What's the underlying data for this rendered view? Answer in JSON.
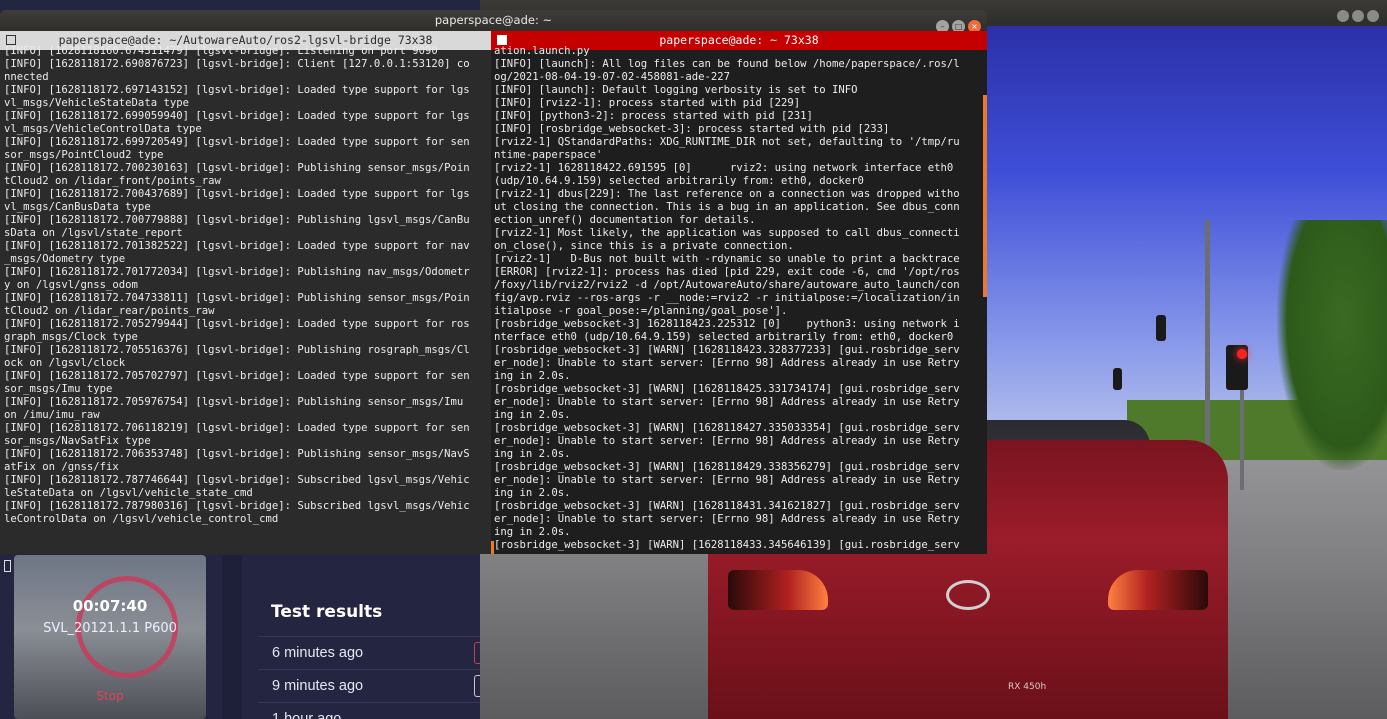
{
  "dashboard": {
    "simulation_card": {
      "timer": "00:07:40",
      "name": "SVL_20121.1.1 P600",
      "stop_label": "Stop"
    },
    "test_results": {
      "title": "Test results",
      "items": [
        {
          "label": "6 minutes ago"
        },
        {
          "label": "9 minutes ago"
        },
        {
          "label": "1 hour ago"
        }
      ]
    }
  },
  "simulator": {
    "car_model": "RX 450h"
  },
  "window_main": {
    "title": "paperspace@ade: ~"
  },
  "terminal_left": {
    "title": "paperspace@ade: ~/AutowareAuto/ros2-lgsvl-bridge 73x38",
    "lines": [
      "[INFO] [1628118160.674311479] [lgsvl-bridge]: Listening on port 9090",
      "[INFO] [1628118172.690876723] [lgsvl-bridge]: Client [127.0.0.1:53120] co",
      "nnected",
      "[INFO] [1628118172.697143152] [lgsvl-bridge]: Loaded type support for lgs",
      "vl_msgs/VehicleStateData type",
      "[INFO] [1628118172.699059940] [lgsvl-bridge]: Loaded type support for lgs",
      "vl_msgs/VehicleControlData type",
      "[INFO] [1628118172.699720549] [lgsvl-bridge]: Loaded type support for sen",
      "sor_msgs/PointCloud2 type",
      "[INFO] [1628118172.700230163] [lgsvl-bridge]: Publishing sensor_msgs/Poin",
      "tCloud2 on /lidar_front/points_raw",
      "[INFO] [1628118172.700437689] [lgsvl-bridge]: Loaded type support for lgs",
      "vl_msgs/CanBusData type",
      "[INFO] [1628118172.700779888] [lgsvl-bridge]: Publishing lgsvl_msgs/CanBu",
      "sData on /lgsvl/state_report",
      "[INFO] [1628118172.701382522] [lgsvl-bridge]: Loaded type support for nav",
      "_msgs/Odometry type",
      "[INFO] [1628118172.701772034] [lgsvl-bridge]: Publishing nav_msgs/Odometr",
      "y on /lgsvl/gnss_odom",
      "[INFO] [1628118172.704733811] [lgsvl-bridge]: Publishing sensor_msgs/Poin",
      "tCloud2 on /lidar_rear/points_raw",
      "[INFO] [1628118172.705279944] [lgsvl-bridge]: Loaded type support for ros",
      "graph_msgs/Clock type",
      "[INFO] [1628118172.705516376] [lgsvl-bridge]: Publishing rosgraph_msgs/Cl",
      "ock on /lgsvl/clock",
      "[INFO] [1628118172.705702797] [lgsvl-bridge]: Loaded type support for sen",
      "sor_msgs/Imu type",
      "[INFO] [1628118172.705976754] [lgsvl-bridge]: Publishing sensor_msgs/Imu ",
      "on /imu/imu_raw",
      "[INFO] [1628118172.706118219] [lgsvl-bridge]: Loaded type support for sen",
      "sor_msgs/NavSatFix type",
      "[INFO] [1628118172.706353748] [lgsvl-bridge]: Publishing sensor_msgs/NavS",
      "atFix on /gnss/fix",
      "[INFO] [1628118172.787746644] [lgsvl-bridge]: Subscribed lgsvl_msgs/Vehic",
      "leStateData on /lgsvl/vehicle_state_cmd",
      "[INFO] [1628118172.787980316] [lgsvl-bridge]: Subscribed lgsvl_msgs/Vehic",
      "leControlData on /lgsvl/vehicle_control_cmd"
    ]
  },
  "terminal_right": {
    "title": "paperspace@ade: ~ 73x38",
    "lines": [
      "ation.launch.py",
      "[INFO] [launch]: All log files can be found below /home/paperspace/.ros/l",
      "og/2021-08-04-19-07-02-458081-ade-227",
      "[INFO] [launch]: Default logging verbosity is set to INFO",
      "[INFO] [rviz2-1]: process started with pid [229]",
      "[INFO] [python3-2]: process started with pid [231]",
      "[INFO] [rosbridge_websocket-3]: process started with pid [233]",
      "[rviz2-1] QStandardPaths: XDG_RUNTIME_DIR not set, defaulting to '/tmp/ru",
      "ntime-paperspace'",
      "[rviz2-1] 1628118422.691595 [0]      rviz2: using network interface eth0",
      "(udp/10.64.9.159) selected arbitrarily from: eth0, docker0",
      "[rviz2-1] dbus[229]: The last reference on a connection was dropped witho",
      "ut closing the connection. This is a bug in an application. See dbus_conn",
      "ection_unref() documentation for details.",
      "[rviz2-1] Most likely, the application was supposed to call dbus_connecti",
      "on_close(), since this is a private connection.",
      "[rviz2-1]   D-Bus not built with -rdynamic so unable to print a backtrace",
      "[ERROR] [rviz2-1]: process has died [pid 229, exit code -6, cmd '/opt/ros",
      "/foxy/lib/rviz2/rviz2 -d /opt/AutowareAuto/share/autoware_auto_launch/con",
      "fig/avp.rviz --ros-args -r __node:=rviz2 -r initialpose:=/localization/in",
      "itialpose -r goal_pose:=/planning/goal_pose'].",
      "[rosbridge_websocket-3] 1628118423.225312 [0]    python3: using network i",
      "nterface eth0 (udp/10.64.9.159) selected arbitrarily from: eth0, docker0",
      "[rosbridge_websocket-3] [WARN] [1628118423.328377233] [gui.rosbridge_serv",
      "er_node]: Unable to start server: [Errno 98] Address already in use Retry",
      "ing in 2.0s.",
      "[rosbridge_websocket-3] [WARN] [1628118425.331734174] [gui.rosbridge_serv",
      "er_node]: Unable to start server: [Errno 98] Address already in use Retry",
      "ing in 2.0s.",
      "[rosbridge_websocket-3] [WARN] [1628118427.335033354] [gui.rosbridge_serv",
      "er_node]: Unable to start server: [Errno 98] Address already in use Retry",
      "ing in 2.0s.",
      "[rosbridge_websocket-3] [WARN] [1628118429.338356279] [gui.rosbridge_serv",
      "er_node]: Unable to start server: [Errno 98] Address already in use Retry",
      "ing in 2.0s.",
      "[rosbridge_websocket-3] [WARN] [1628118431.341621827] [gui.rosbridge_serv",
      "er_node]: Unable to start server: [Errno 98] Address already in use Retry",
      "ing in 2.0s.",
      "[rosbridge_websocket-3] [WARN] [1628118433.345646139] [gui.rosbridge_serv"
    ]
  }
}
